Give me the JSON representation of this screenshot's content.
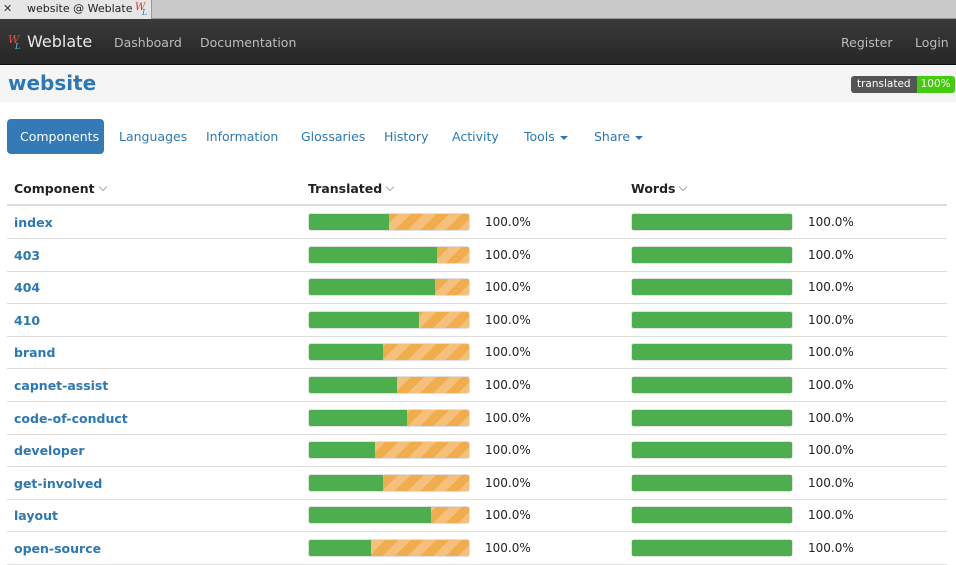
{
  "browser": {
    "tab_title": "website @ Weblate"
  },
  "navbar": {
    "brand": "Weblate",
    "links": [
      "Dashboard",
      "Documentation"
    ],
    "right_links": [
      "Register",
      "Login"
    ]
  },
  "header": {
    "title": "website",
    "badge_label": "translated",
    "badge_value": "100%"
  },
  "tabs": [
    {
      "label": "Components",
      "active": true
    },
    {
      "label": "Languages"
    },
    {
      "label": "Information"
    },
    {
      "label": "Glossaries"
    },
    {
      "label": "History"
    },
    {
      "label": "Activity"
    },
    {
      "label": "Tools",
      "dropdown": true
    },
    {
      "label": "Share",
      "dropdown": true
    }
  ],
  "table": {
    "columns": [
      "Component",
      "Translated",
      "Words"
    ],
    "rows": [
      {
        "name": "index",
        "translated": "100.0%",
        "words": "100.0%",
        "translated_green": 0.5
      },
      {
        "name": "403",
        "translated": "100.0%",
        "words": "100.0%",
        "translated_green": 0.8
      },
      {
        "name": "404",
        "translated": "100.0%",
        "words": "100.0%",
        "translated_green": 0.79
      },
      {
        "name": "410",
        "translated": "100.0%",
        "words": "100.0%",
        "translated_green": 0.69
      },
      {
        "name": "brand",
        "translated": "100.0%",
        "words": "100.0%",
        "translated_green": 0.46
      },
      {
        "name": "capnet-assist",
        "translated": "100.0%",
        "words": "100.0%",
        "translated_green": 0.55
      },
      {
        "name": "code-of-conduct",
        "translated": "100.0%",
        "words": "100.0%",
        "translated_green": 0.61
      },
      {
        "name": "developer",
        "translated": "100.0%",
        "words": "100.0%",
        "translated_green": 0.41
      },
      {
        "name": "get-involved",
        "translated": "100.0%",
        "words": "100.0%",
        "translated_green": 0.46
      },
      {
        "name": "layout",
        "translated": "100.0%",
        "words": "100.0%",
        "translated_green": 0.76
      },
      {
        "name": "open-source",
        "translated": "100.0%",
        "words": "100.0%",
        "translated_green": 0.39
      }
    ]
  },
  "colors": {
    "brand_blue": "#2b78b5",
    "success_green": "#4cae4c",
    "warning_orange": "#f0ad4e",
    "navbar_dark": "#2d2d2d"
  }
}
